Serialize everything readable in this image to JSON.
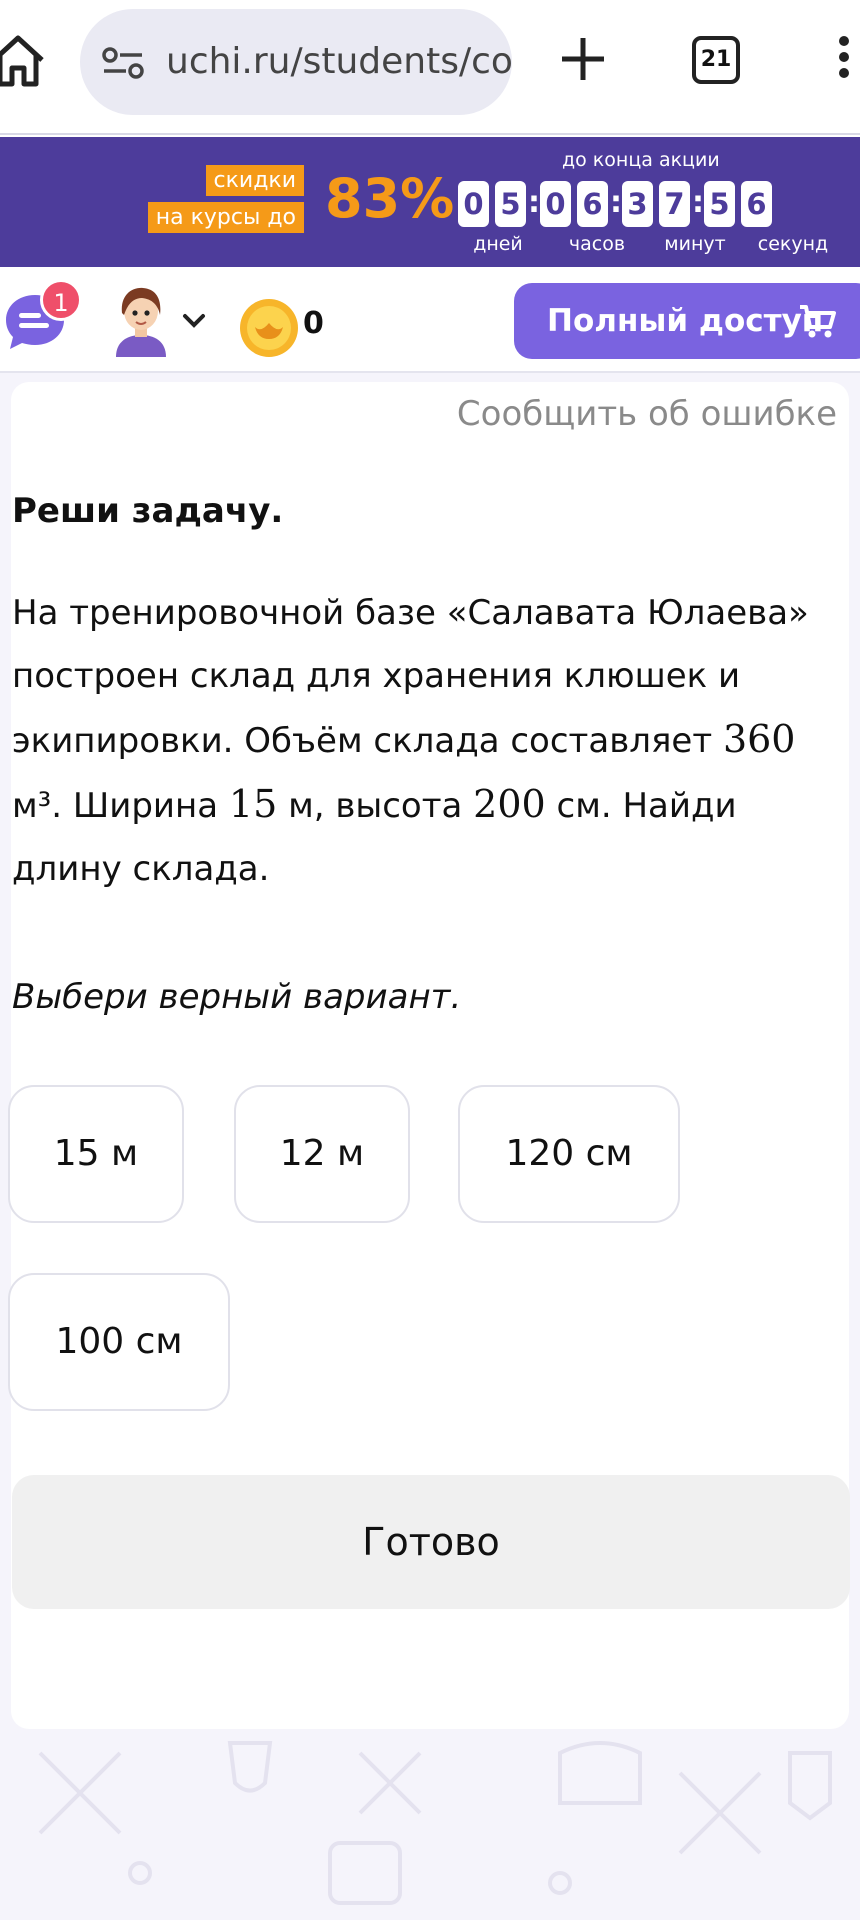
{
  "browser": {
    "url": "uchi.ru/students/cor",
    "tab_count": "21"
  },
  "promo": {
    "badge_line1": "скидки",
    "badge_line2": "на курсы до",
    "percent": "83%",
    "until_label": "до конца акции",
    "timer_digits": [
      "0",
      "5",
      "0",
      "6",
      "3",
      "7",
      "5",
      "6"
    ],
    "timer_labels": [
      "дней",
      "часов",
      "минут",
      "секунд"
    ],
    "colors": {
      "background": "#4d3c9b",
      "accent": "#f59a18"
    }
  },
  "header": {
    "chat_badge": "1",
    "coins": "0",
    "full_access_label": "Полный доступ",
    "icons": [
      "chat-icon",
      "avatar",
      "chevron-down-icon",
      "coin-icon",
      "cart-icon"
    ],
    "colors": {
      "button": "#7a63e0",
      "badge": "#ef4f6a"
    }
  },
  "card": {
    "report_link": "Сообщить об ошибке",
    "heading": "Реши задачу.",
    "text_part1": "На тренировочной базе «Салавата Юлаева» построен склад для хранения клюшек и экипировки. Объём склада составляет ",
    "volume": "360",
    "text_part2": " м³. Ширина ",
    "width": "15",
    "text_part3": " м, высота ",
    "height": "200",
    "text_part4": " см. Найди длину склада.",
    "hint": "Выбери верный вариант.",
    "options": [
      "15 м",
      "12 м",
      "120 см",
      "100 см"
    ],
    "done_label": "Готово"
  }
}
